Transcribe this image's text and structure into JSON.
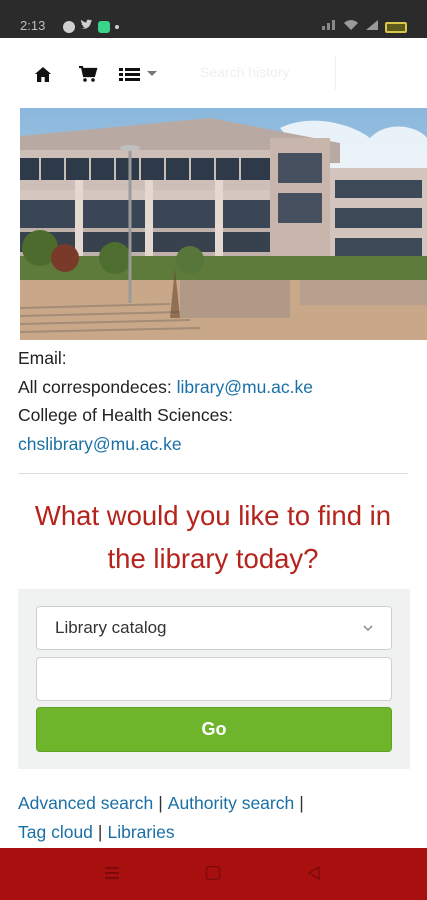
{
  "status_bar": {
    "time": "2:13",
    "icons": [
      "messenger-icon",
      "twitter-icon",
      "app-icon",
      "dot-icon",
      "sim-icon",
      "wifi-icon",
      "signal-icon",
      "battery-icon"
    ]
  },
  "navbar": {
    "icons": [
      "home-icon",
      "cart-icon",
      "list-icon"
    ],
    "faint_text": "Search history"
  },
  "contact": {
    "email_label": "Email:",
    "correspondence_label": "All correspondeces:",
    "correspondence_email": "library@mu.ac.ke",
    "college_label": "College of Health Sciences:",
    "college_email": "chslibrary@mu.ac.ke"
  },
  "headline": "What would you like to find in the library today?",
  "search": {
    "selected_option": "Library catalog",
    "query_value": "",
    "go_label": "Go"
  },
  "links": {
    "advanced": "Advanced search",
    "authority": "Authority search",
    "tag_cloud": "Tag cloud",
    "libraries": "Libraries",
    "separator": "|"
  },
  "colors": {
    "headline": "#b5231c",
    "link": "#1a70a6",
    "go_button": "#6fb52c",
    "bottom_bar": "#a80f0f"
  }
}
